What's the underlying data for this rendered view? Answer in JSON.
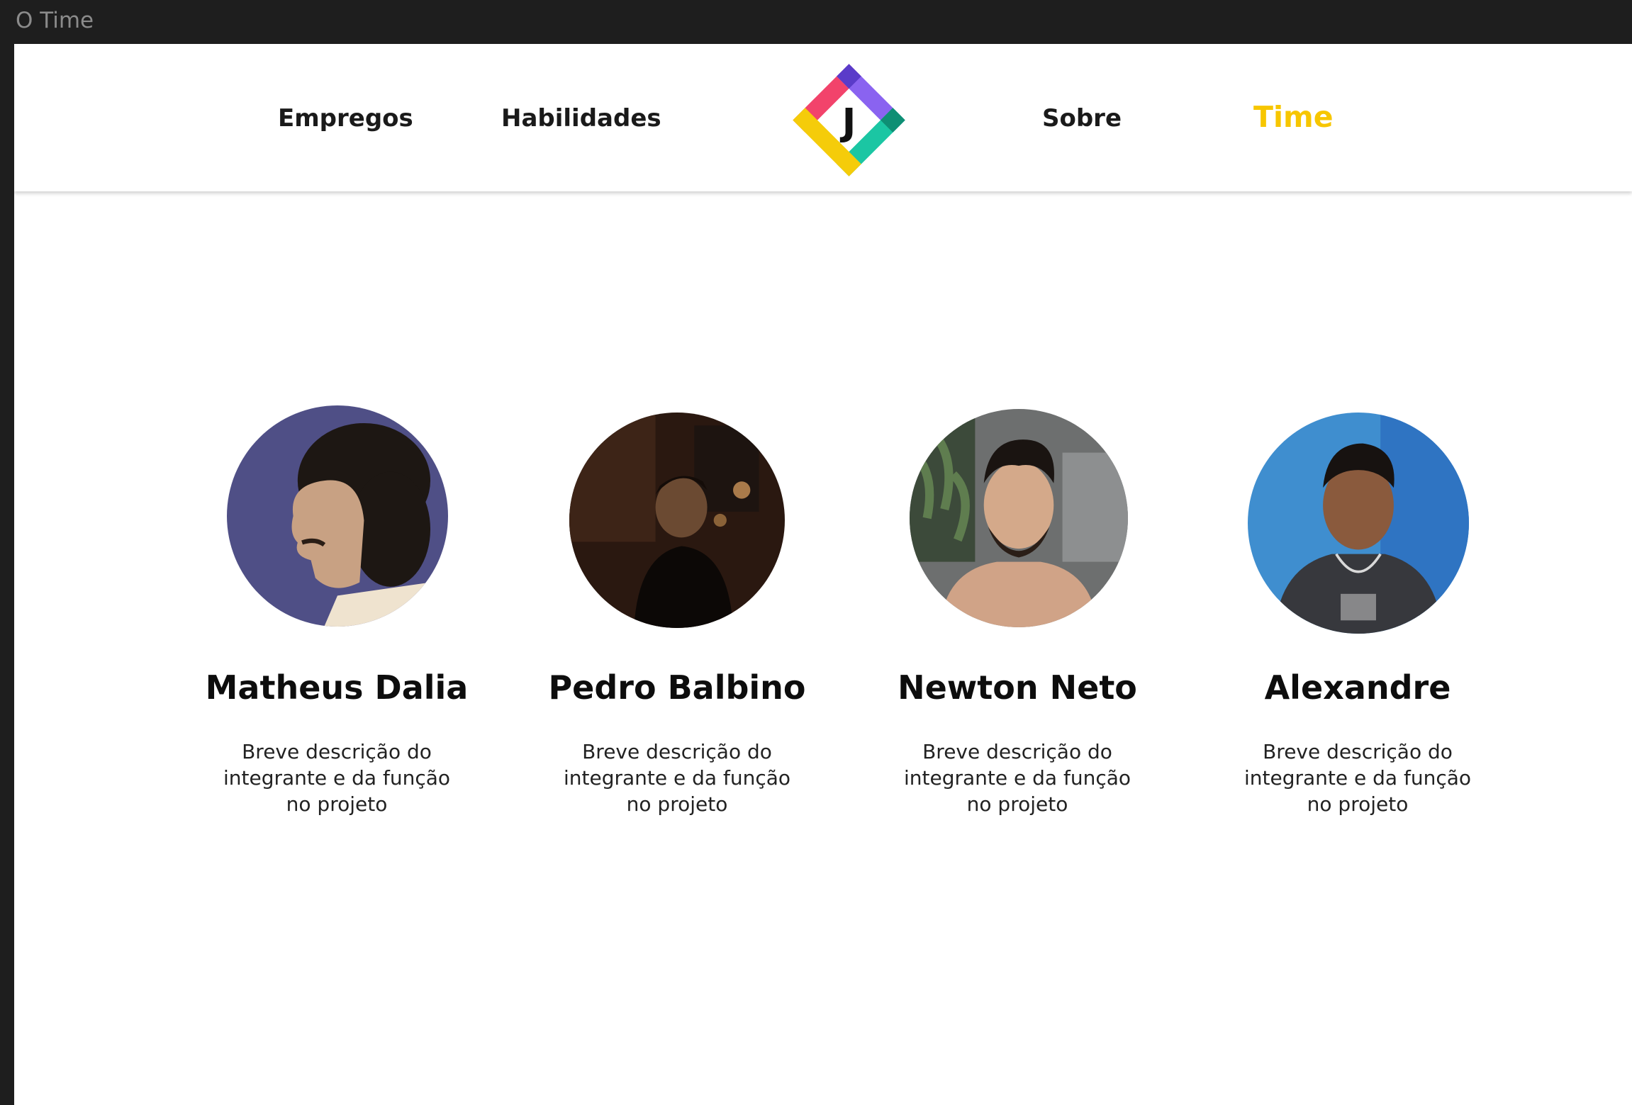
{
  "window": {
    "title": "O Time"
  },
  "nav": {
    "links": [
      {
        "label": "Empregos"
      },
      {
        "label": "Habilidades"
      },
      {
        "label": "Sobre"
      },
      {
        "label": "Time"
      }
    ],
    "active": "Time",
    "logo_letter": "J",
    "logo_colors": [
      "#8a63f0",
      "#1bc6a3",
      "#f2436b",
      "#f5cc0a"
    ]
  },
  "team": {
    "members": [
      {
        "name": "Matheus Dalia",
        "description": "Breve descrição do integrante e da função no projeto"
      },
      {
        "name": "Pedro Balbino",
        "description": "Breve descrição do integrante e da função no projeto"
      },
      {
        "name": "Newton Neto",
        "description": "Breve descrição do integrante e da função no projeto"
      },
      {
        "name": "Alexandre",
        "description": "Breve descrição do integrante e da função no projeto"
      }
    ]
  },
  "colors": {
    "active_link": "#f7c600",
    "text": "#1a1a1a",
    "background": "#ffffff",
    "chrome": "#1e1e1e"
  }
}
